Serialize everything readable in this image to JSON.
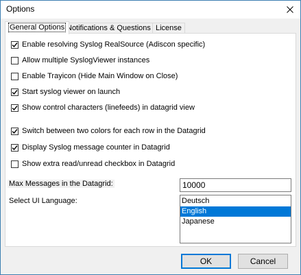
{
  "window": {
    "title": "Options"
  },
  "tabs": [
    {
      "label": "General Options",
      "active": true
    },
    {
      "label": "Notifications & Questions",
      "active": false
    },
    {
      "label": "License",
      "active": false
    }
  ],
  "checkboxes": [
    {
      "label": "Enable resolving Syslog RealSource (Adiscon specific)",
      "checked": true
    },
    {
      "label": "Allow multiple SyslogViewer instances",
      "checked": false
    },
    {
      "label": "Enable Trayicon (Hide Main Window on Close)",
      "checked": false
    },
    {
      "label": "Start syslog viewer on launch",
      "checked": true
    },
    {
      "label": "Show control characters (linefeeds) in datagrid view",
      "checked": true
    },
    {
      "label": "Switch between two colors for each row in the Datagrid",
      "checked": true
    },
    {
      "label": "Display Syslog message counter in Datagrid",
      "checked": true
    },
    {
      "label": "Show extra read/unread checkbox in Datagrid",
      "checked": false
    }
  ],
  "max_messages": {
    "label": "Max Messages in the Datagrid:",
    "value": "10000"
  },
  "ui_language": {
    "label": "Select UI Language:",
    "options": [
      "Deutsch",
      "English",
      "Japanese"
    ],
    "selected": "English"
  },
  "buttons": {
    "ok": "OK",
    "cancel": "Cancel"
  },
  "colors": {
    "accent": "#0078d7",
    "border": "#3c7fb1"
  }
}
